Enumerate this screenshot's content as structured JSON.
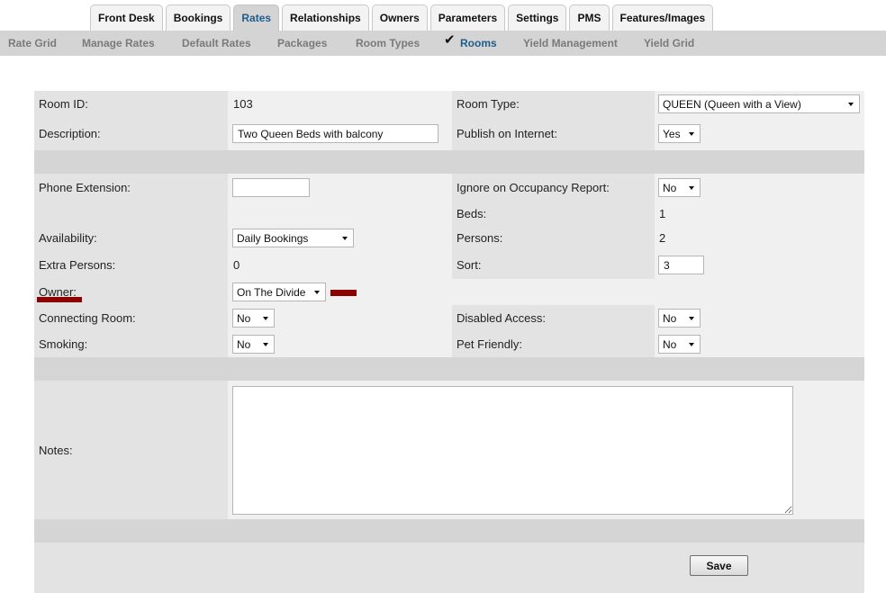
{
  "tabs": [
    {
      "label": "Front Desk"
    },
    {
      "label": "Bookings"
    },
    {
      "label": "Rates"
    },
    {
      "label": "Relationships"
    },
    {
      "label": "Owners"
    },
    {
      "label": "Parameters"
    },
    {
      "label": "Settings"
    },
    {
      "label": "PMS"
    },
    {
      "label": "Features/Images"
    }
  ],
  "active_tab": "Rates",
  "subnav": [
    {
      "label": "Rate Grid"
    },
    {
      "label": "Manage Rates"
    },
    {
      "label": "Default Rates"
    },
    {
      "label": "Packages"
    },
    {
      "label": "Room Types"
    },
    {
      "label": "Rooms"
    },
    {
      "label": "Yield Management"
    },
    {
      "label": "Yield Grid"
    }
  ],
  "active_subnav": "Rooms",
  "icons": {
    "active_marker": "checkmark-icon",
    "select_caret": "chevron-down-icon"
  },
  "colors": {
    "active": "#1f5d8c",
    "highlight": "#8b0000"
  },
  "form": {
    "room_id": {
      "label": "Room ID:",
      "value": "103"
    },
    "room_type": {
      "label": "Room Type:",
      "value": "QUEEN (Queen with a View)"
    },
    "description": {
      "label": "Description:",
      "value": "Two Queen Beds with balcony"
    },
    "publish": {
      "label": "Publish on Internet:",
      "value": "Yes"
    },
    "phone_extension": {
      "label": "Phone Extension:",
      "value": ""
    },
    "ignore_occupancy": {
      "label": "Ignore on Occupancy Report:",
      "value": "No"
    },
    "beds": {
      "label": "Beds:",
      "value": "1"
    },
    "availability": {
      "label": "Availability:",
      "value": "Daily Bookings"
    },
    "persons": {
      "label": "Persons:",
      "value": "2"
    },
    "extra_persons": {
      "label": "Extra Persons:",
      "value": "0"
    },
    "sort": {
      "label": "Sort:",
      "value": "3"
    },
    "owner": {
      "label": "Owner:",
      "value": "On The Divide"
    },
    "connecting_room": {
      "label": "Connecting Room:",
      "value": "No"
    },
    "disabled_access": {
      "label": "Disabled Access:",
      "value": "No"
    },
    "smoking": {
      "label": "Smoking:",
      "value": "No"
    },
    "pet_friendly": {
      "label": "Pet Friendly:",
      "value": "No"
    },
    "notes": {
      "label": "Notes:",
      "value": ""
    }
  },
  "save_label": "Save"
}
